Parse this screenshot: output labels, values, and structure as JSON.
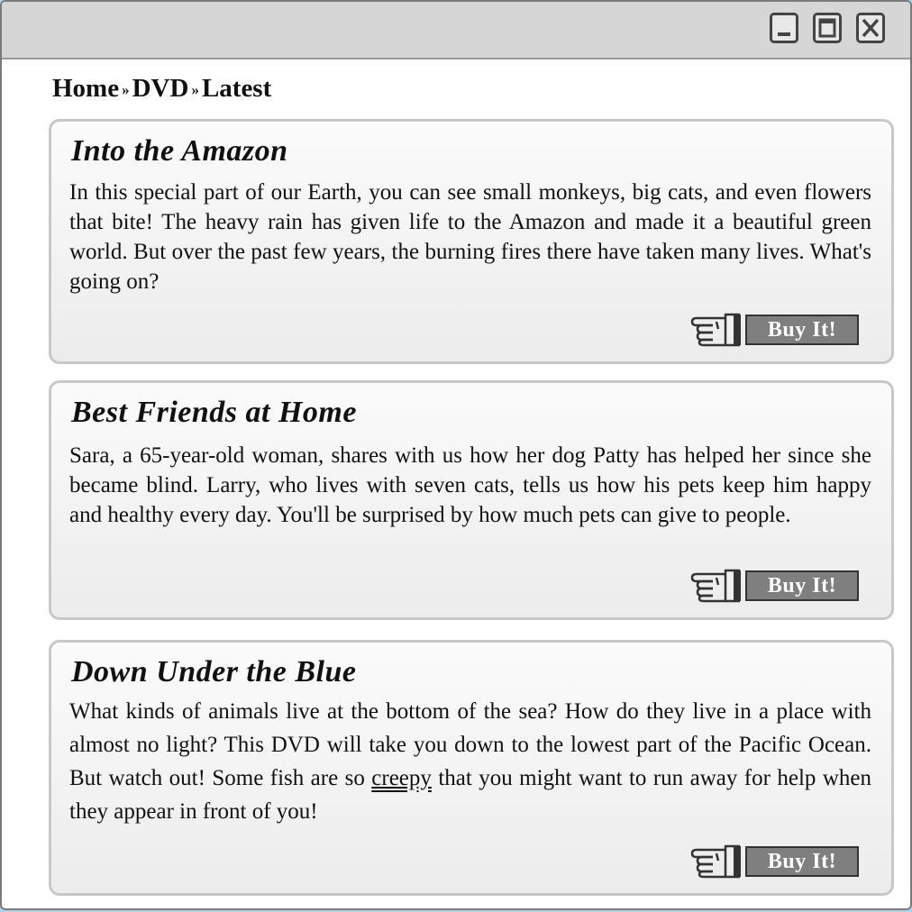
{
  "breadcrumb": {
    "home": "Home",
    "dvd": "DVD",
    "latest": "Latest",
    "separator": "»"
  },
  "window_controls": [
    "minimize-icon",
    "maximize-icon",
    "close-icon"
  ],
  "cards": [
    {
      "title": "Into the Amazon",
      "description": "In this special part of our Earth, you can see small monkeys, big cats, and even flowers that bite!  The heavy rain has given life to the Amazon and made it a beautiful green world.  But over the past few years, the burning fires there have taken many lives.  What's going on?",
      "buy_label": "Buy It!"
    },
    {
      "title": "Best Friends at Home",
      "description": "Sara, a 65-year-old woman, shares with us how her dog Patty has helped her since she became blind.  Larry, who lives with seven cats, tells us how his pets keep him happy and healthy every day.  You'll be surprised by how much pets can give to people.",
      "buy_label": "Buy It!"
    },
    {
      "title": "Down Under the Blue",
      "description_part1": "What kinds of animals live at the bottom of the sea?  How do they live in a place with almost no light?  This DVD will take you down to the lowest part of the Pacific Ocean.  But watch out!  Some fish are so ",
      "description_underlined": "creepy",
      "description_part2": " that you might want to run away for help when they appear in front of you!",
      "buy_label": "Buy It!"
    }
  ],
  "colors": {
    "background": "#a9d6ee",
    "titlebar": "#d6d6d6",
    "button": "#7f7f7f"
  }
}
